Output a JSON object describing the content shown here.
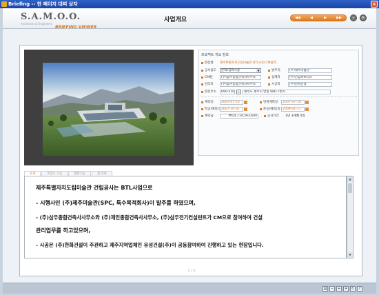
{
  "window": {
    "title": "Briefing -- 한 페이지 대피 상자"
  },
  "header": {
    "logo": "S.A.M.O.O.",
    "logo_sub": "Architects & Engineers",
    "logo_viewer": "BRIEFING VIEWER",
    "page_title": "사업개요"
  },
  "project_info": {
    "title": "프로젝트 개요 정보",
    "name_label": "현장명",
    "name_value": "제주특별자치도립미술관 BTL사업 CM용역",
    "use_label": "공사용도",
    "use_value": "문화/집회시설",
    "owner_label": "발주처",
    "owner_value": "(주)제주미술관",
    "cm_label": "CM社",
    "cm_value": "(주)삼우종합건축사사무소",
    "designer_label": "설계자",
    "designer_value": "(주)간삼파트너스",
    "supervisor_label": "감리자",
    "supervisor_value": "(주)삼우종합건축사사무소",
    "contractor_label": "시공자",
    "contractor_value": "(주)한화건설",
    "address_label": "현장주소",
    "postcode_value": "690-510",
    "address_value": "제주도 제주시 연동 680-7번지",
    "contract_date_label": "계약일",
    "contract_date_value": "2007-07-10",
    "change_contract_label": "변경계약일",
    "change_contract_value": "2007-07-10",
    "start_date_label": "착공(예정)일",
    "start_date_value": "2007-10-31",
    "completion_date_label": "준공(예정)일",
    "completion_date_value": "2009-01-11",
    "amount_label": "계약금",
    "amount_value": "₩14,714,593,600",
    "period_label": "공사기간",
    "period_value": "1년 3개월 0일"
  },
  "tabs": [
    "소개",
    "조감도 기능",
    "평면기능",
    "참 자료"
  ],
  "description": {
    "line1": "제주특별자치도립미술관 건립공사는 BTL사업으로",
    "line2": "- 시행사인 (주)제주미술관(SPC, 특수목적회사)이 발주를 하였으며,",
    "line3": "- (주)삼우종합건축사사무소와 (주)제인종합건축사사무소, (주)삼우전기컨설턴트가 CM으로 참여하여 건설",
    "line4": "관리업무를 하고있으며,",
    "line5": "- 시공은 (주)한화건설이 주관하고 제주지역업체인 유성건설(주)이 공동참여하여 진행하고 있는 현장입니다."
  },
  "pager": "1 / 5",
  "colors": {
    "accent": "#d57a19",
    "titlebar": "#2a5bc4"
  }
}
